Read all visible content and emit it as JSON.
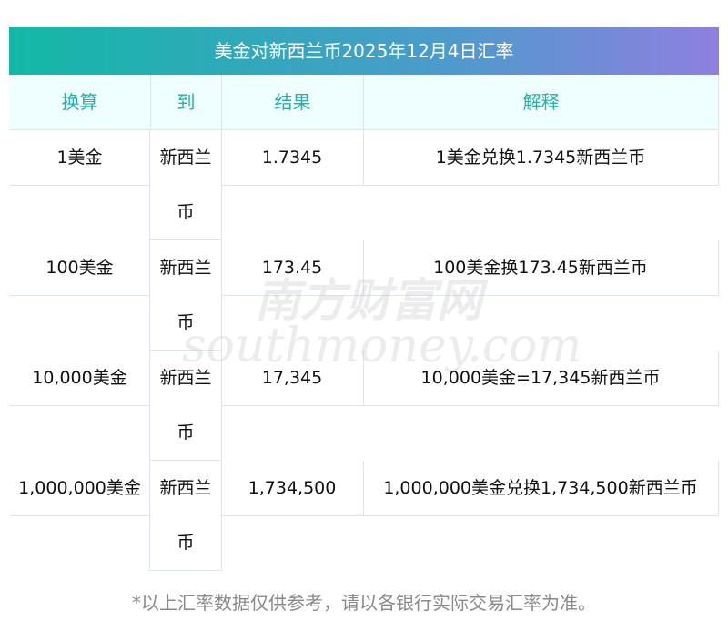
{
  "title": "美金对新西兰币2025年12月4日汇率",
  "headers": [
    "换算",
    "到",
    "结果",
    "解释"
  ],
  "rows": [
    {
      "from": "1美金",
      "to": "新西兰币",
      "result": "1.7345",
      "explain": "1美金兑换1.7345新西兰币"
    },
    {
      "from": "100美金",
      "to": "新西兰币",
      "result": "173.45",
      "explain": "100美金换173.45新西兰币"
    },
    {
      "from": "10,000美金",
      "to": "新西兰币",
      "result": "17,345",
      "explain": "10,000美金=17,345新西兰币"
    },
    {
      "from": "1,000,000美金",
      "to": "新西兰币",
      "result": "1,734,500",
      "explain": "1,000,000美金兑换1,734,500新西兰币"
    }
  ],
  "note": "*以上汇率数据仅供参考，请以各银行实际交易汇率为准。",
  "watermark": {
    "cn": "南方财富网",
    "en": "southmoney.com"
  }
}
